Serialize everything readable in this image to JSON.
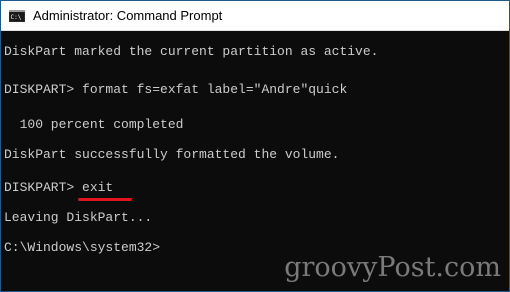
{
  "window": {
    "title": "Administrator: Command Prompt",
    "icon": "cmd-console-icon"
  },
  "console": {
    "lines": [
      "DiskPart marked the current partition as active.",
      "DISKPART> format fs=exfat label=\"Andre\"quick",
      "  100 percent completed",
      "DiskPart successfully formatted the volume.",
      "DISKPART> exit",
      "Leaving DiskPart...",
      "C:\\Windows\\system32>"
    ],
    "highlighted_command": "exit",
    "highlight_color": "#e0141e"
  },
  "watermark": {
    "text": "groovyPost.com"
  },
  "colors": {
    "console_background": "#0c0c0c",
    "console_text": "#cccccc",
    "titlebar_background": "#ffffff",
    "window_border": "#1e5a8c"
  }
}
